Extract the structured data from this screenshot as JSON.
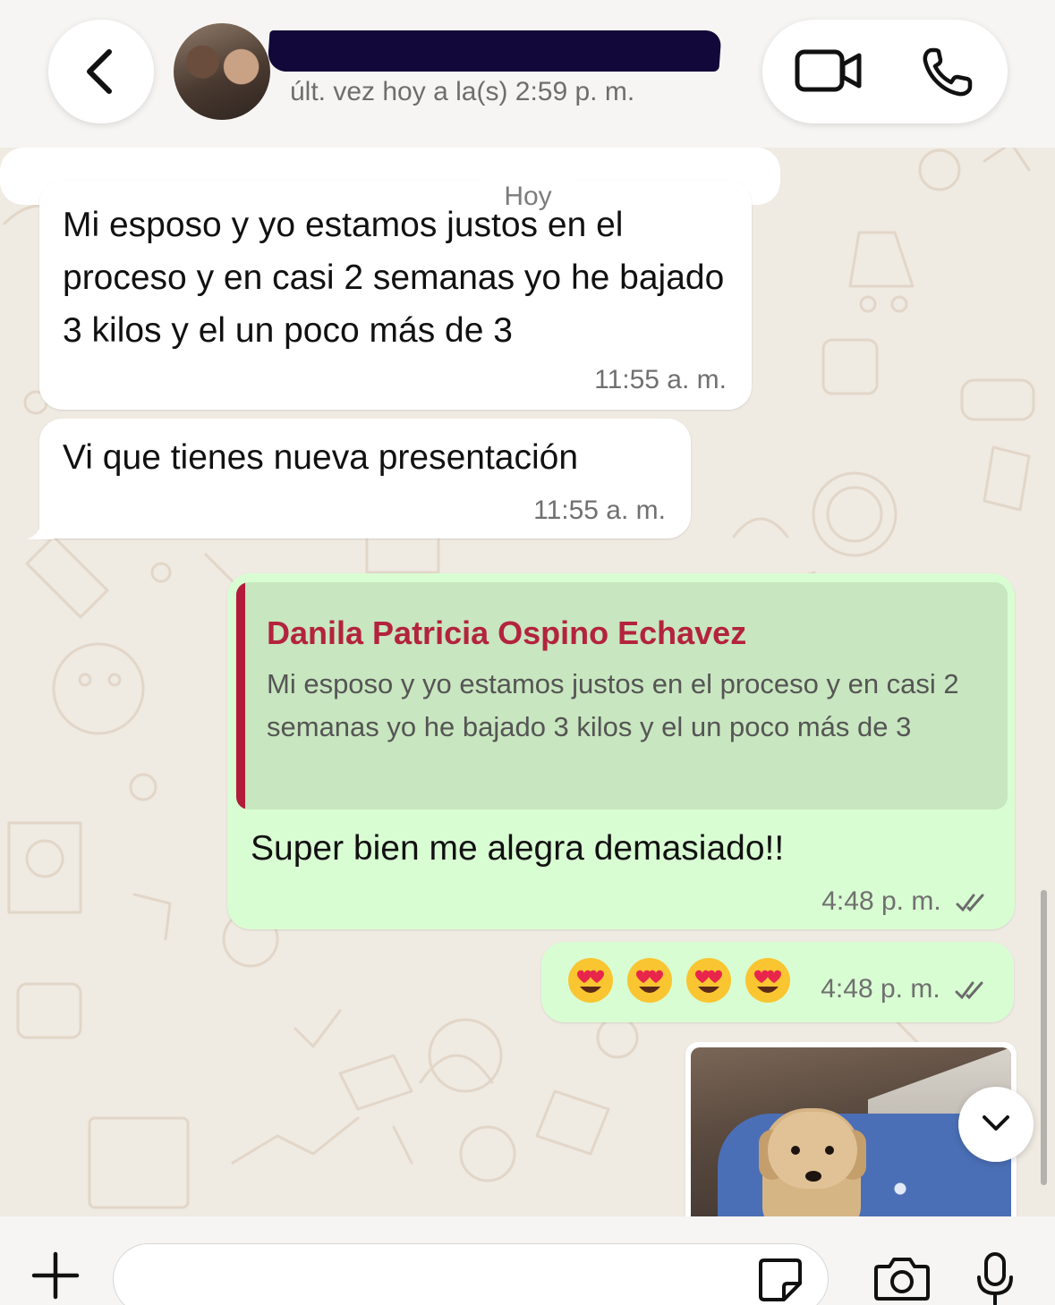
{
  "header": {
    "last_seen": "últ. vez hoy a la(s) 2:59 p. m.",
    "icons": {
      "back": "chevron-left-icon",
      "video": "video-camera-icon",
      "call": "phone-icon"
    }
  },
  "chat": {
    "date_chip": "Hoy",
    "messages": [
      {
        "direction": "incoming",
        "text": "Mi esposo y yo estamos justos en el proceso y en casi 2 semanas yo he bajado 3 kilos y el un poco más de 3",
        "time": "11:55 a. m."
      },
      {
        "direction": "incoming",
        "text": "Vi que tienes nueva presentación",
        "time": "11:55 a. m."
      },
      {
        "direction": "outgoing",
        "reply_to": {
          "author": "Danila Patricia Ospino Echavez",
          "text": "Mi esposo y yo estamos justos en el proceso y en casi 2 semanas yo he bajado 3 kilos y el un poco más de 3"
        },
        "text": "Super bien me alegra demasiado!!",
        "time": "4:48 p. m.",
        "status": "read"
      },
      {
        "direction": "outgoing",
        "emojis": [
          "😍",
          "😍",
          "😍",
          "😍"
        ],
        "time": "4:48 p. m.",
        "status": "read"
      },
      {
        "direction": "outgoing",
        "type": "image",
        "description": "puppy-photo"
      }
    ]
  },
  "input_bar": {
    "placeholder": "",
    "icons": {
      "add": "plus-icon",
      "sticker": "sticker-icon",
      "camera": "camera-icon",
      "mic": "microphone-icon"
    }
  },
  "colors": {
    "incoming_bubble": "#ffffff",
    "outgoing_bubble": "#d9fdd3",
    "reply_accent": "#b3233e",
    "read_ticks": "#6b6b6b",
    "wallpaper": "#efeae2"
  }
}
